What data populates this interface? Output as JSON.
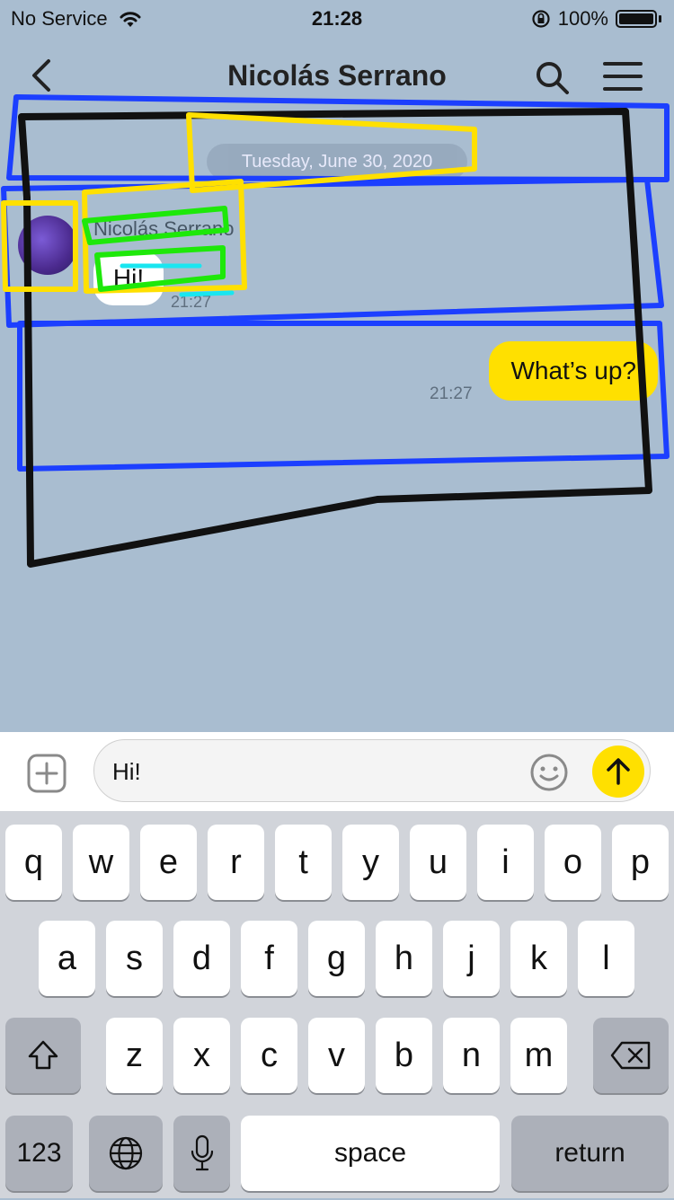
{
  "status_bar": {
    "carrier": "No Service",
    "time": "21:28",
    "battery": "100%"
  },
  "nav": {
    "title": "Nicolás Serrano",
    "back_icon": "chevron-left-icon",
    "search_icon": "search-icon",
    "menu_icon": "hamburger-menu-icon"
  },
  "chat": {
    "date_label": "Tuesday, June 30, 2020",
    "incoming": {
      "sender": "Nicolás Serrano",
      "text": "Hi!",
      "time": "21:27"
    },
    "outgoing": {
      "text": "What’s up?",
      "time": "21:27"
    }
  },
  "composer": {
    "value": "Hi!",
    "plus_icon": "plus-square-icon",
    "emoji_icon": "emoji-icon",
    "send_icon": "arrow-up-icon"
  },
  "keyboard": {
    "row1": [
      "q",
      "w",
      "e",
      "r",
      "t",
      "y",
      "u",
      "i",
      "o",
      "p"
    ],
    "row2": [
      "a",
      "s",
      "d",
      "f",
      "g",
      "h",
      "j",
      "k",
      "l"
    ],
    "row3": [
      "z",
      "x",
      "c",
      "v",
      "b",
      "n",
      "m"
    ],
    "numbers": "123",
    "space": "space",
    "return": "return"
  },
  "colors": {
    "chat_bg": "#a9bdd0",
    "outgoing_bubble": "#ffe000",
    "incoming_bubble": "#ffffff",
    "send_button": "#ffe000"
  }
}
